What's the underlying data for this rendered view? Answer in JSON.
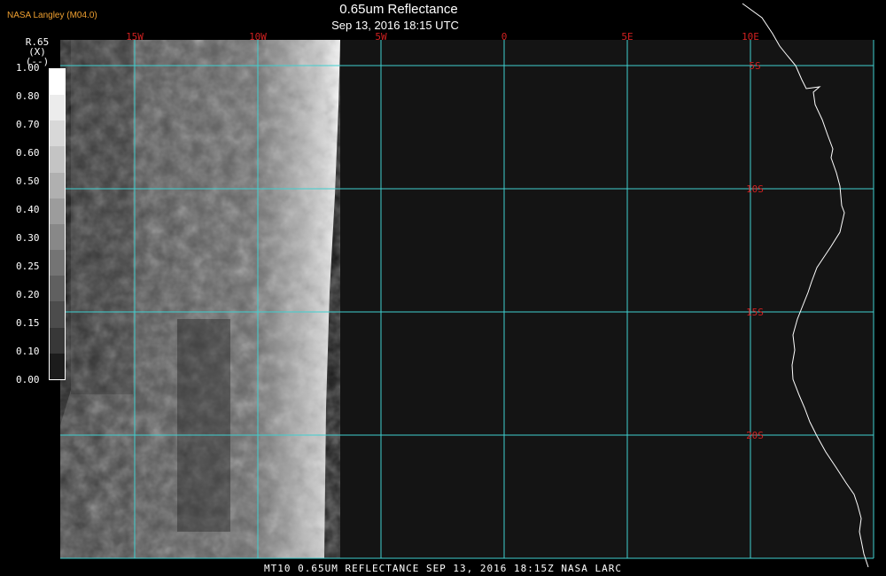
{
  "header": {
    "credit": "NASA Langley (M04.0)",
    "title": "0.65um Reflectance",
    "subtitle": "Sep 13, 2016 18:15 UTC"
  },
  "footer": {
    "caption": "MT10  0.65UM REFLECTANCE   SEP 13, 2016 18:15Z   NASA LARC"
  },
  "legend": {
    "name_line1": "R.65",
    "name_line2": "(X)",
    "name_line3": "(--)",
    "labels": [
      "1.00",
      "0.80",
      "0.70",
      "0.60",
      "0.50",
      "0.40",
      "0.30",
      "0.25",
      "0.20",
      "0.15",
      "0.10",
      "0.00"
    ],
    "grays": [
      "#ffffff",
      "#ececec",
      "#d8d8d8",
      "#c4c4c4",
      "#b0b0b0",
      "#9c9c9c",
      "#888888",
      "#747474",
      "#606060",
      "#4c4c4c",
      "#383838",
      "#1c1c1c"
    ]
  },
  "map": {
    "grid_color": "#3fd0d0",
    "label_color": "#d02020",
    "coast_color": "#ffffff",
    "longitude_labels": [
      "15W",
      "10W",
      "5W",
      "0",
      "5E",
      "10E"
    ],
    "latitude_labels": [
      "5S",
      "10S",
      "15S",
      "20S"
    ]
  }
}
